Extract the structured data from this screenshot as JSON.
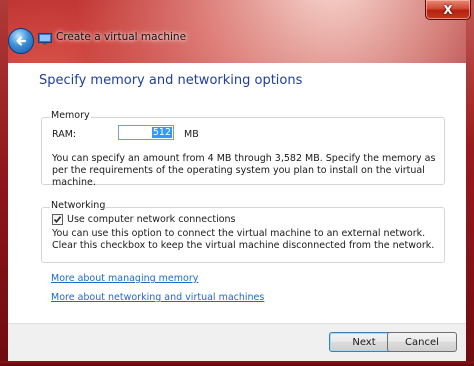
{
  "window": {
    "title": "Create a virtual machine",
    "close_glyph": "X"
  },
  "page": {
    "heading": "Specify memory and networking options"
  },
  "memory": {
    "group_title": "Memory",
    "ram_label": "RAM:",
    "ram_value": "512",
    "ram_unit": "MB",
    "description": "You can specify an amount from 4 MB through 3,582 MB. Specify the memory as per the requirements of the operating system you plan to install on the virtual machine."
  },
  "networking": {
    "group_title": "Networking",
    "checkbox_checked": true,
    "checkbox_label": "Use computer network connections",
    "description": "You can use this option to connect the virtual machine to an external network. Clear this checkbox to keep the virtual machine disconnected from the network."
  },
  "links": {
    "managing_memory": "More about managing memory",
    "networking_vms": "More about networking and virtual machines"
  },
  "buttons": {
    "next": "Next",
    "cancel": "Cancel"
  },
  "icons": {
    "close": "close-icon",
    "back": "back-arrow-icon",
    "app": "virtual-machine-icon",
    "check": "checkmark-icon"
  },
  "colors": {
    "heading": "#1e3f9e",
    "link": "#1a6cc8",
    "selection": "#3399ff"
  }
}
